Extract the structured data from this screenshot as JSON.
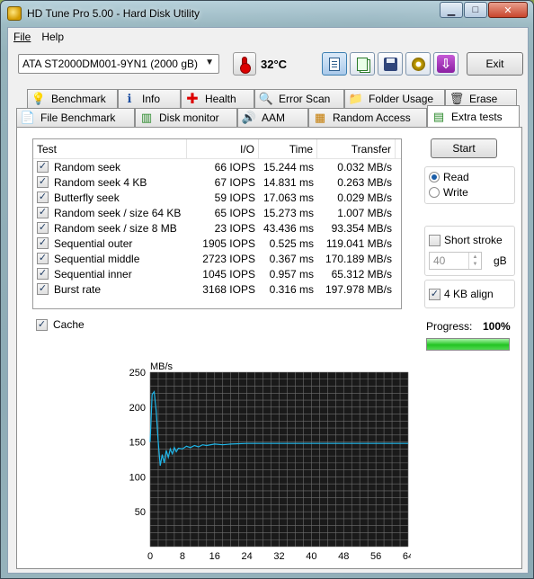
{
  "window": {
    "title": "HD Tune Pro 5.00 - Hard Disk Utility",
    "controls": {
      "minimize": "▁",
      "maximize": "□",
      "close": "✕"
    }
  },
  "menu": {
    "file": "File",
    "help": "Help"
  },
  "toolbar": {
    "drive": "ATA    ST2000DM001-9YN1 (2000 gB)",
    "temperature": "32°C",
    "exit_label": "Exit",
    "buttons": [
      "copy-text-icon",
      "copy-screenshot-icon",
      "save-icon",
      "options-icon",
      "download-icon"
    ]
  },
  "tabs_top": [
    {
      "label": "Benchmark",
      "icon": "benchmark-icon"
    },
    {
      "label": "Info",
      "icon": "info-icon"
    },
    {
      "label": "Health",
      "icon": "health-icon"
    },
    {
      "label": "Error Scan",
      "icon": "error-scan-icon"
    },
    {
      "label": "Folder Usage",
      "icon": "folder-icon"
    },
    {
      "label": "Erase",
      "icon": "erase-icon"
    }
  ],
  "tabs_bottom": [
    {
      "label": "File Benchmark",
      "icon": "file-benchmark-icon"
    },
    {
      "label": "Disk monitor",
      "icon": "disk-monitor-icon"
    },
    {
      "label": "AAM",
      "icon": "speaker-icon"
    },
    {
      "label": "Random Access",
      "icon": "random-access-icon"
    },
    {
      "label": "Extra tests",
      "icon": "extra-tests-icon"
    }
  ],
  "results": {
    "headers": {
      "test": "Test",
      "io": "I/O",
      "time": "Time",
      "transfer": "Transfer"
    },
    "rows": [
      {
        "test": "Random seek",
        "io": "66 IOPS",
        "time": "15.244 ms",
        "transfer": "0.032 MB/s",
        "checked": true
      },
      {
        "test": "Random seek 4 KB",
        "io": "67 IOPS",
        "time": "14.831 ms",
        "transfer": "0.263 MB/s",
        "checked": true
      },
      {
        "test": "Butterfly seek",
        "io": "59 IOPS",
        "time": "17.063 ms",
        "transfer": "0.029 MB/s",
        "checked": true
      },
      {
        "test": "Random seek / size 64 KB",
        "io": "65 IOPS",
        "time": "15.273 ms",
        "transfer": "1.007 MB/s",
        "checked": true
      },
      {
        "test": "Random seek / size 8 MB",
        "io": "23 IOPS",
        "time": "43.436 ms",
        "transfer": "93.354 MB/s",
        "checked": true
      },
      {
        "test": "Sequential outer",
        "io": "1905 IOPS",
        "time": "0.525 ms",
        "transfer": "119.041 MB/s",
        "checked": true
      },
      {
        "test": "Sequential middle",
        "io": "2723 IOPS",
        "time": "0.367 ms",
        "transfer": "170.189 MB/s",
        "checked": true
      },
      {
        "test": "Sequential inner",
        "io": "1045 IOPS",
        "time": "0.957 ms",
        "transfer": "65.312 MB/s",
        "checked": true
      },
      {
        "test": "Burst rate",
        "io": "3168 IOPS",
        "time": "0.316 ms",
        "transfer": "197.978 MB/s",
        "checked": true
      }
    ]
  },
  "cache": {
    "label": "Cache",
    "checked": true
  },
  "controls": {
    "start_label": "Start",
    "read_label": "Read",
    "write_label": "Write",
    "mode": "read",
    "short_stroke_label": "Short stroke",
    "short_stroke_checked": false,
    "short_stroke_value": "40",
    "short_stroke_unit": "gB",
    "align_label": "4 KB align",
    "align_checked": true,
    "progress_label": "Progress:",
    "progress_text": "100%",
    "progress_fraction": 1.0
  },
  "chart_data": {
    "type": "line",
    "ylabel": "MB/s",
    "xunit": "MB",
    "xlim": [
      0,
      64
    ],
    "ylim": [
      0,
      250
    ],
    "xticks": [
      0,
      8,
      16,
      24,
      32,
      40,
      48,
      56,
      64
    ],
    "yticks": [
      50,
      100,
      150,
      200,
      250
    ],
    "grid": true,
    "colors": {
      "background": "#1a1a1a",
      "grid": "#6f6f6f",
      "line": "#1fb7ea"
    },
    "series": [
      {
        "x": [
          0,
          0.5,
          1,
          1.5,
          2,
          2.5,
          3,
          3.5,
          4,
          4.5,
          5,
          5.5,
          6,
          6.5,
          7,
          8,
          9,
          10,
          11,
          12,
          13,
          14,
          16,
          18,
          20,
          24,
          28,
          32,
          36,
          40,
          44,
          48,
          52,
          56,
          60,
          64
        ],
        "y": [
          150,
          218,
          222,
          195,
          150,
          116,
          132,
          120,
          138,
          128,
          140,
          133,
          142,
          136,
          141,
          140,
          144,
          142,
          145,
          143,
          146,
          145,
          147,
          146,
          147,
          148,
          148,
          148,
          148,
          148,
          148,
          148,
          148,
          148,
          148,
          148
        ]
      }
    ]
  }
}
